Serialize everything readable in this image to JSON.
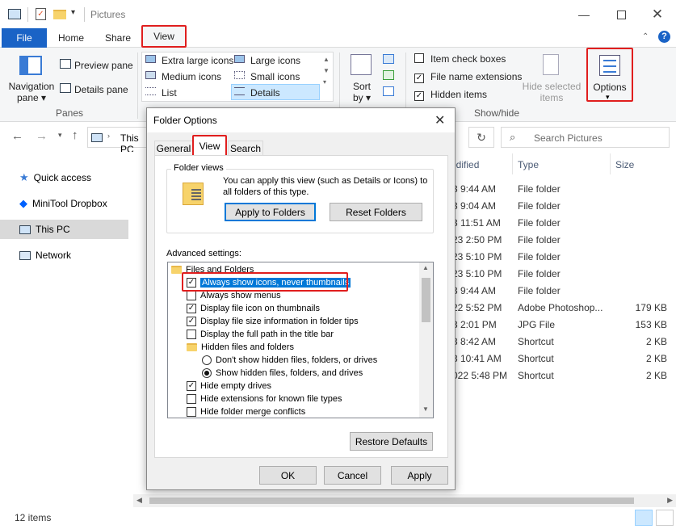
{
  "window": {
    "title": "Pictures"
  },
  "menu": {
    "file": "File",
    "home": "Home",
    "share": "Share",
    "view": "View"
  },
  "ribbon": {
    "navigation_pane": "Navigation",
    "navigation_pane2": "pane",
    "preview_pane": "Preview pane",
    "details_pane": "Details pane",
    "panes_group": "Panes",
    "layout": [
      "Extra large icons",
      "Large icons",
      "Medium icons",
      "Small icons",
      "List",
      "Details"
    ],
    "sort_by": "Sort",
    "sort_by2": "by",
    "item_check_boxes": "Item check boxes",
    "file_name_extensions": "File name extensions",
    "hidden_items": "Hidden items",
    "hide_selected": "Hide selected",
    "hide_selected2": "items",
    "showhide_group": "Show/hide",
    "options": "Options"
  },
  "nav": {
    "path": "This PC",
    "search_placeholder": "Search Pictures"
  },
  "sidebar": {
    "items": [
      "Quick access",
      "MiniTool Dropbox",
      "This PC",
      "Network"
    ]
  },
  "columns": {
    "modified": "odified",
    "type": "Type",
    "size": "Size"
  },
  "files": [
    {
      "date": "3 9:44 AM",
      "type": "File folder",
      "size": ""
    },
    {
      "date": "3 9:04 AM",
      "type": "File folder",
      "size": ""
    },
    {
      "date": "3 11:51 AM",
      "type": "File folder",
      "size": ""
    },
    {
      "date": "23 2:50 PM",
      "type": "File folder",
      "size": ""
    },
    {
      "date": "23 5:10 PM",
      "type": "File folder",
      "size": ""
    },
    {
      "date": "23 5:10 PM",
      "type": "File folder",
      "size": ""
    },
    {
      "date": "3 9:44 AM",
      "type": "File folder",
      "size": ""
    },
    {
      "date": "22 5:52 PM",
      "type": "Adobe Photoshop...",
      "size": "179 KB"
    },
    {
      "date": "3 2:01 PM",
      "type": "JPG File",
      "size": "153 KB"
    },
    {
      "date": "3 8:42 AM",
      "type": "Shortcut",
      "size": "2 KB"
    },
    {
      "date": "3 10:41 AM",
      "type": "Shortcut",
      "size": "2 KB"
    },
    {
      "date": "022 5:48 PM",
      "type": "Shortcut",
      "size": "2 KB"
    }
  ],
  "status": {
    "count": "12 items"
  },
  "dialog": {
    "title": "Folder Options",
    "tabs": [
      "General",
      "View",
      "Search"
    ],
    "folder_views_label": "Folder views",
    "folder_views_desc1": "You can apply this view (such as Details or Icons) to",
    "folder_views_desc2": "all folders of this type.",
    "apply_to_folders": "Apply to Folders",
    "reset_folders": "Reset Folders",
    "advanced_label": "Advanced settings:",
    "settings": [
      {
        "kind": "folder",
        "label": "Files and Folders",
        "indent": 0
      },
      {
        "kind": "check",
        "label": "Always show icons, never thumbnails",
        "checked": true,
        "indent": 1
      },
      {
        "kind": "check",
        "label": "Always show menus",
        "checked": false,
        "indent": 1
      },
      {
        "kind": "check",
        "label": "Display file icon on thumbnails",
        "checked": true,
        "indent": 1
      },
      {
        "kind": "check",
        "label": "Display file size information in folder tips",
        "checked": true,
        "indent": 1
      },
      {
        "kind": "check",
        "label": "Display the full path in the title bar",
        "checked": false,
        "indent": 1
      },
      {
        "kind": "folder",
        "label": "Hidden files and folders",
        "indent": 1
      },
      {
        "kind": "radio",
        "label": "Don't show hidden files, folders, or drives",
        "checked": false,
        "indent": 2
      },
      {
        "kind": "radio",
        "label": "Show hidden files, folders, and drives",
        "checked": true,
        "indent": 2
      },
      {
        "kind": "check",
        "label": "Hide empty drives",
        "checked": true,
        "indent": 1
      },
      {
        "kind": "check",
        "label": "Hide extensions for known file types",
        "checked": false,
        "indent": 1
      },
      {
        "kind": "check",
        "label": "Hide folder merge conflicts",
        "checked": false,
        "indent": 1
      }
    ],
    "restore_defaults": "Restore Defaults",
    "ok": "OK",
    "cancel": "Cancel",
    "apply": "Apply"
  },
  "colors": {
    "accent": "#1a63c6",
    "highlight_red": "#e01e1e",
    "selection": "#0078d7"
  }
}
